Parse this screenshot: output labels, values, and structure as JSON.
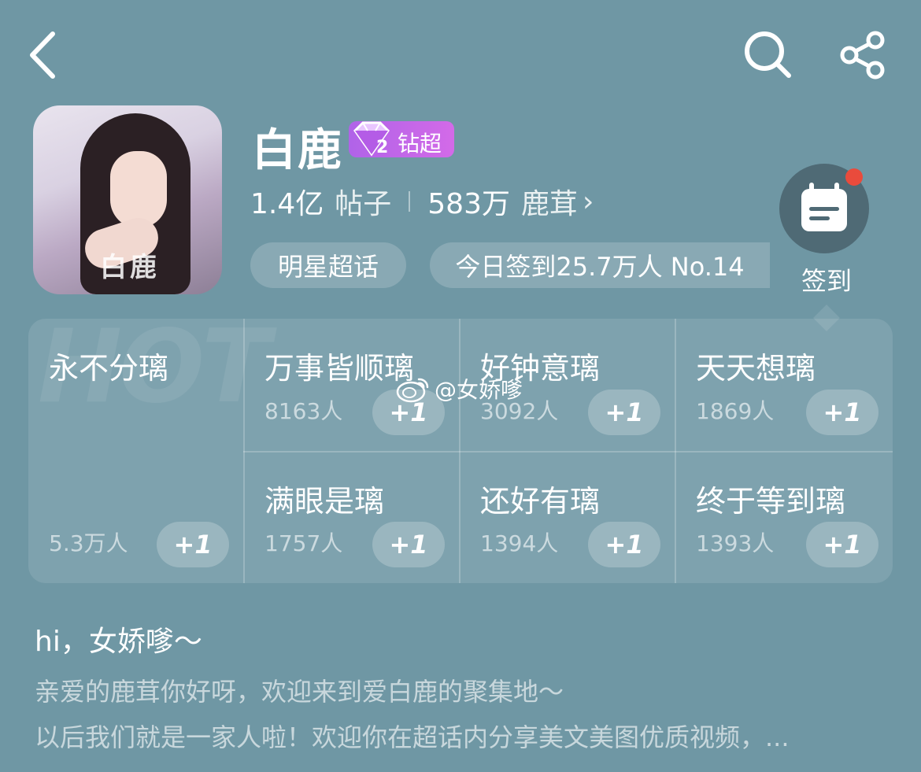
{
  "topbar": {
    "back_icon": "back-arrow-icon",
    "search_icon": "search-icon",
    "share_icon": "share-icon"
  },
  "header": {
    "title": "白鹿",
    "badge": {
      "level": "2",
      "label": "钻超",
      "color": "#c165e8"
    },
    "posts_count": "1.4亿",
    "posts_label": "帖子",
    "fans_count": "583万",
    "fans_label": "鹿茸",
    "fans_arrow": "›",
    "avatar_text": "白鹿",
    "chips": [
      {
        "label": "明星超话"
      },
      {
        "label": "今日签到25.7万人 No.14"
      }
    ],
    "checkin_label": "签到"
  },
  "grid": {
    "bg_text": "HOT",
    "items": [
      {
        "name": "永不分璃",
        "count": "5.3万人",
        "action": "+1"
      },
      {
        "name": "万事皆顺璃",
        "count": "8163人",
        "action": "+1"
      },
      {
        "name": "好钟意璃",
        "count": "3092人",
        "action": "+1"
      },
      {
        "name": "天天想璃",
        "count": "1869人",
        "action": "+1"
      },
      {
        "name": "满眼是璃",
        "count": "1757人",
        "action": "+1"
      },
      {
        "name": "还好有璃",
        "count": "1394人",
        "action": "+1"
      },
      {
        "name": "终于等到璃",
        "count": "1393人",
        "action": "+1"
      }
    ]
  },
  "watermark": "@女娇嗲",
  "intro": {
    "greeting": "hi，女娇嗲～",
    "line1": "亲爱的鹿茸你好呀，欢迎来到爱白鹿的聚集地～",
    "line2": "以后我们就是一家人啦！欢迎你在超话内分享美文美图优质视频，..."
  }
}
